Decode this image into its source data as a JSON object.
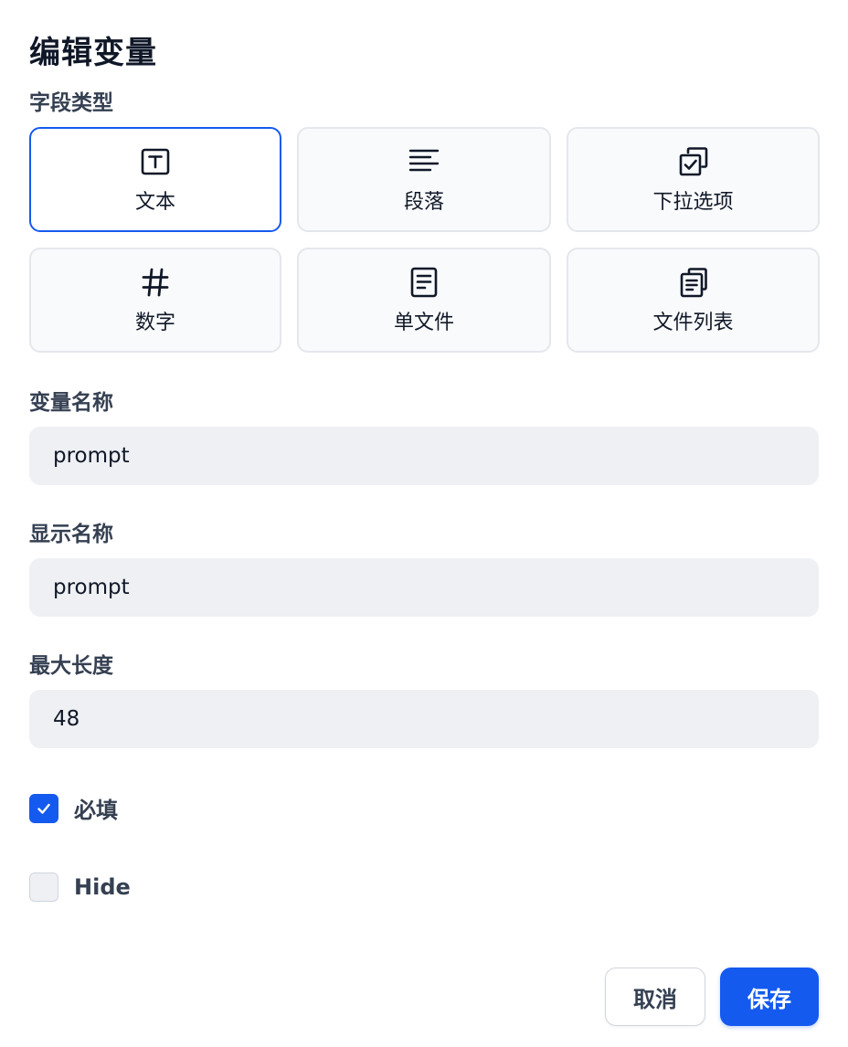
{
  "dialog": {
    "title": "编辑变量",
    "field_type_label": "字段类型",
    "field_types": [
      {
        "label": "文本",
        "icon": "text-input-icon",
        "selected": true
      },
      {
        "label": "段落",
        "icon": "paragraph-icon",
        "selected": false
      },
      {
        "label": "下拉选项",
        "icon": "select-options-icon",
        "selected": false
      },
      {
        "label": "数字",
        "icon": "hash-icon",
        "selected": false
      },
      {
        "label": "单文件",
        "icon": "file-icon",
        "selected": false
      },
      {
        "label": "文件列表",
        "icon": "file-list-icon",
        "selected": false
      }
    ],
    "variable_name": {
      "label": "变量名称",
      "value": "prompt"
    },
    "display_name": {
      "label": "显示名称",
      "value": "prompt"
    },
    "max_length": {
      "label": "最大长度",
      "value": "48"
    },
    "required": {
      "label": "必填",
      "checked": true
    },
    "hide": {
      "label": "Hide",
      "checked": false
    },
    "buttons": {
      "cancel": "取消",
      "save": "保存"
    }
  },
  "colors": {
    "accent": "#155aef",
    "input_bg": "#eef0f3",
    "border": "#e4e7ec",
    "text": "#101828",
    "label": "#354052"
  }
}
